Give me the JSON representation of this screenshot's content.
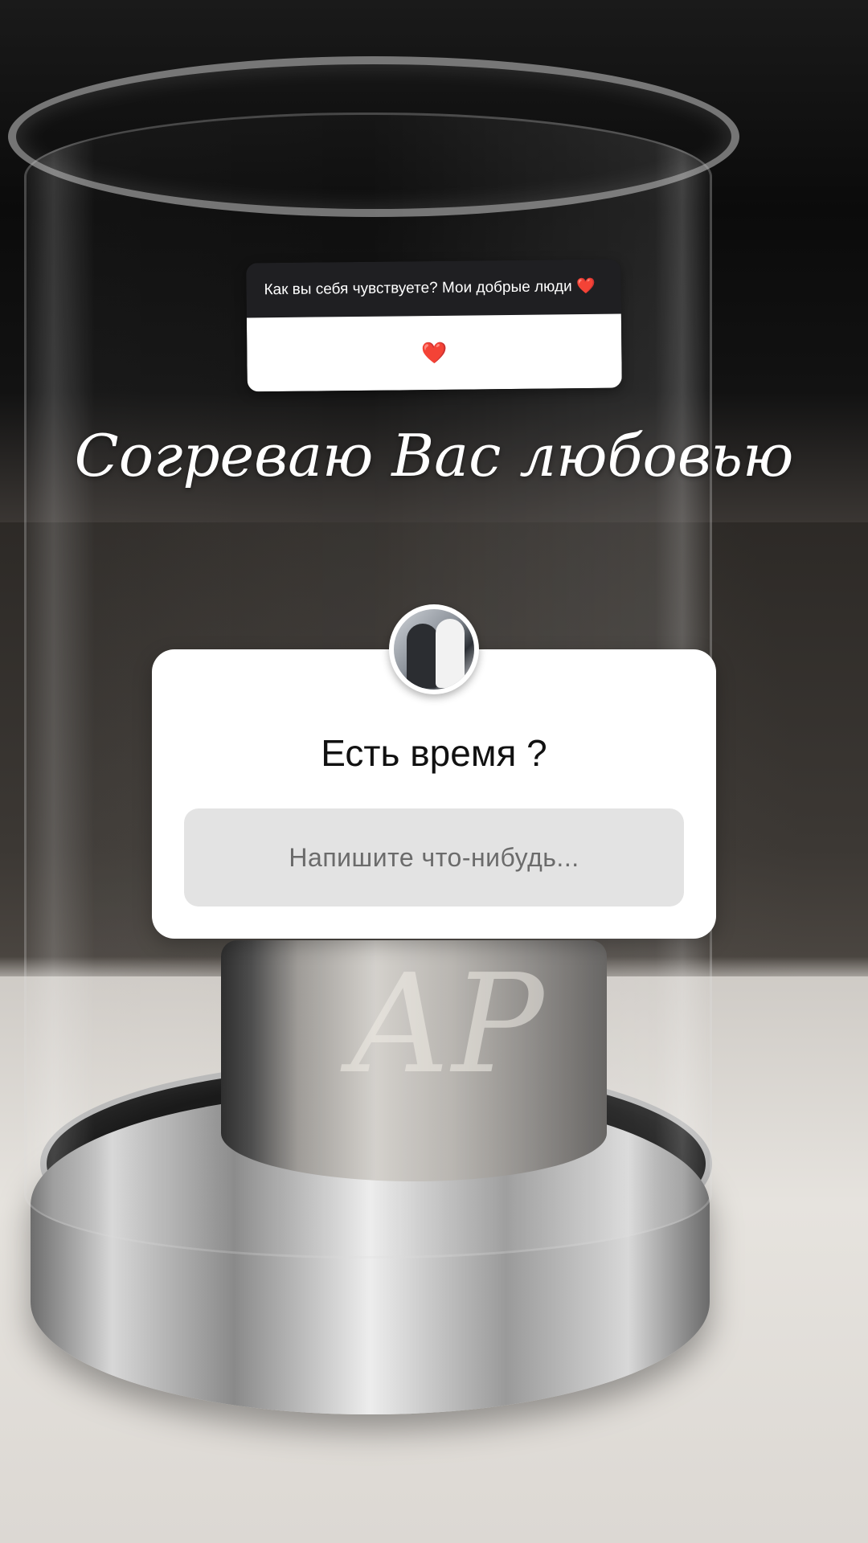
{
  "reply_sticker": {
    "question": "Как вы себя чувствуете? Мои добрые люди ❤️",
    "answer": "❤️"
  },
  "caption": "Согреваю Вас любовью",
  "question_sticker": {
    "title": "Есть время ?",
    "input_placeholder": "Напишите что-нибудь..."
  },
  "background": {
    "monogram": "АР"
  },
  "icons": {
    "heart": "red-heart-emoji",
    "avatar": "profile-avatar"
  },
  "colors": {
    "sticker_dark": "#1f1f22",
    "sticker_light": "#ffffff",
    "input_bg": "#e3e3e3",
    "caption_text": "#ffffff"
  }
}
